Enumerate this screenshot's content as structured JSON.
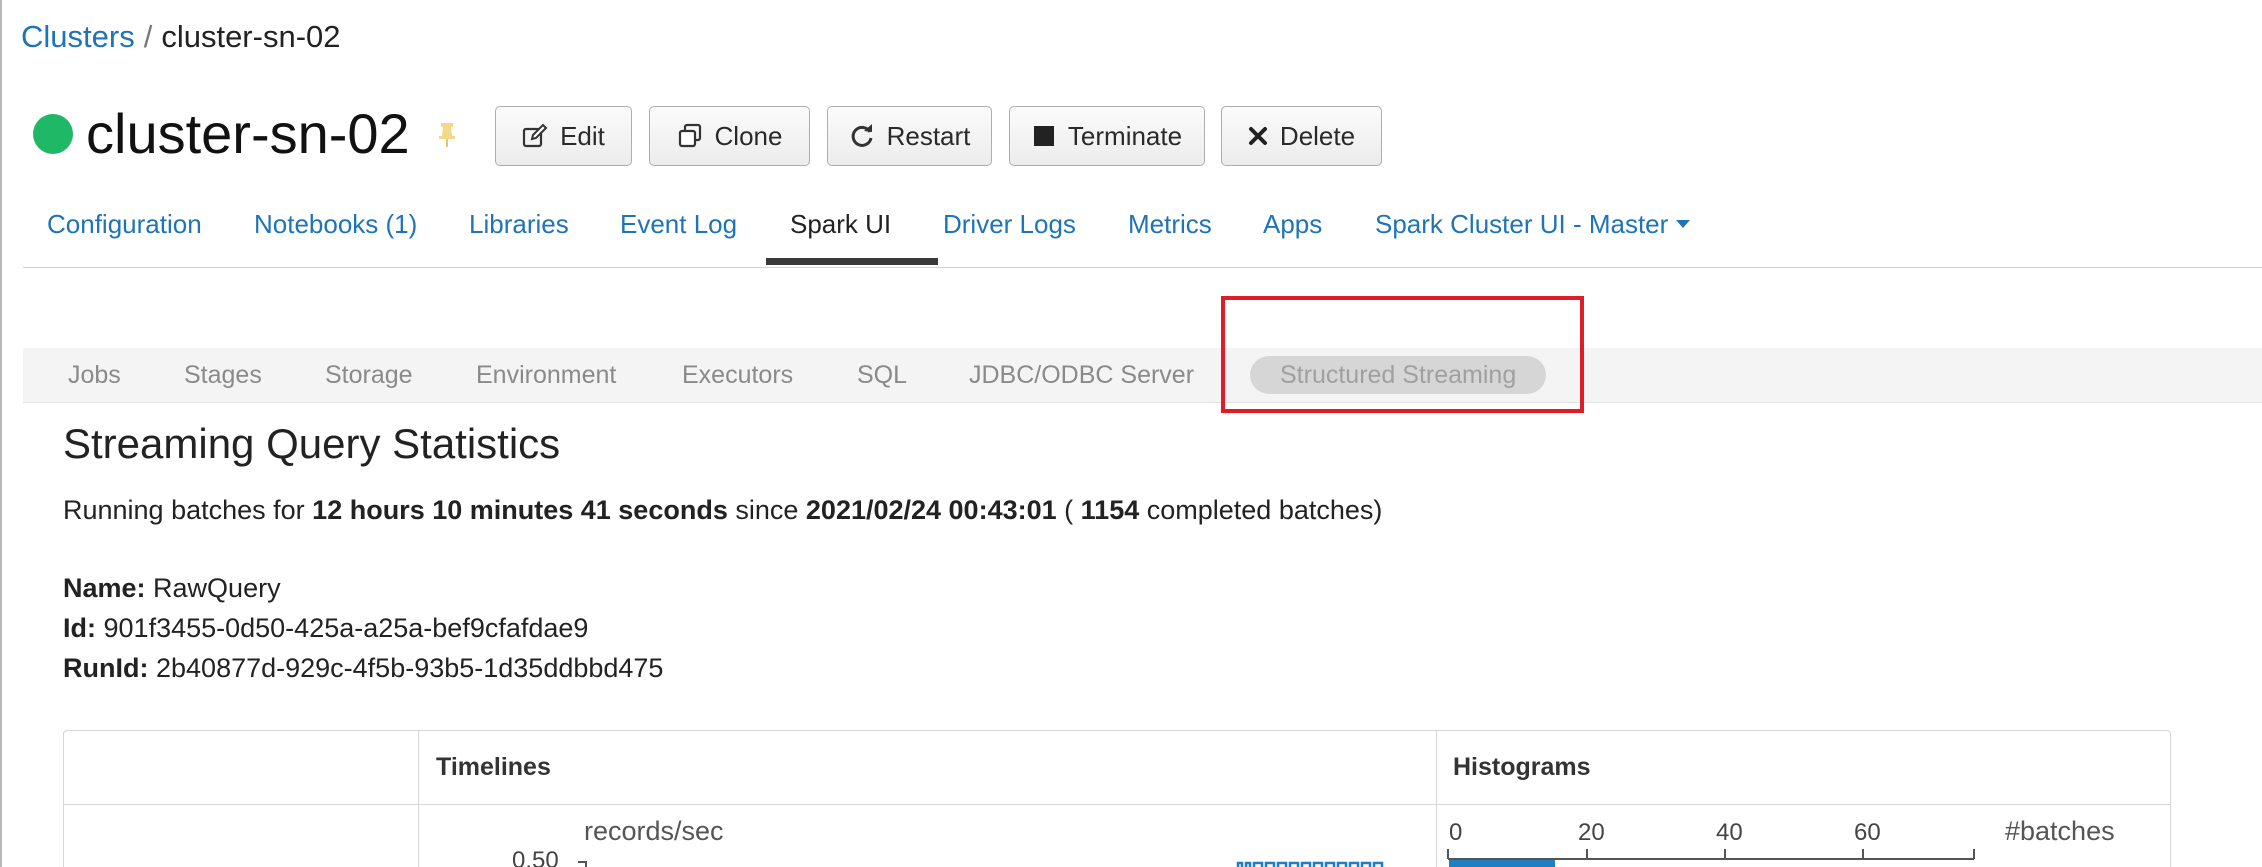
{
  "breadcrumb": {
    "parent": "Clusters",
    "separator": "/",
    "current": "cluster-sn-02"
  },
  "header": {
    "title": "cluster-sn-02",
    "status": "running",
    "status_color": "#1eb866",
    "pin_icon": "pin-icon",
    "buttons": {
      "edit": "Edit",
      "clone": "Clone",
      "restart": "Restart",
      "terminate": "Terminate",
      "delete": "Delete"
    }
  },
  "cluster_tabs": {
    "configuration": "Configuration",
    "notebooks": "Notebooks (1)",
    "libraries": "Libraries",
    "event_log": "Event Log",
    "spark_ui": "Spark UI",
    "driver_logs": "Driver Logs",
    "metrics": "Metrics",
    "apps": "Apps",
    "spark_cluster_ui": "Spark Cluster UI - Master",
    "active": "Spark UI"
  },
  "spark_nav": {
    "jobs": "Jobs",
    "stages": "Stages",
    "storage": "Storage",
    "environment": "Environment",
    "executors": "Executors",
    "sql": "SQL",
    "jdbc": "JDBC/ODBC Server",
    "structured_streaming": "Structured Streaming",
    "active": "Structured Streaming",
    "highlight_color": "#dd1e28"
  },
  "stats": {
    "title": "Streaming Query Statistics",
    "running_prefix": "Running batches for",
    "duration": "12 hours 10 minutes 41 seconds",
    "since_label": "since",
    "start_time": "2021/02/24 00:43:01",
    "paren_open": "(",
    "completed_batches": "1154",
    "completed_suffix": "completed batches)",
    "name_label": "Name:",
    "name_value": "RawQuery",
    "id_label": "Id:",
    "id_value": "901f3455-0d50-425a-a25a-bef9cfafdae9",
    "runid_label": "RunId:",
    "runid_value": "2b40877d-929c-4f5b-93b5-1d35ddbbd475"
  },
  "table": {
    "col_timelines": "Timelines",
    "col_histograms": "Histograms",
    "timeline_unit": "records/sec",
    "timeline_tick": "0.50",
    "histogram_unit": "#batches",
    "histogram_ticks": [
      "0",
      "20",
      "40",
      "60"
    ],
    "accent_color": "#1f7fc4"
  }
}
